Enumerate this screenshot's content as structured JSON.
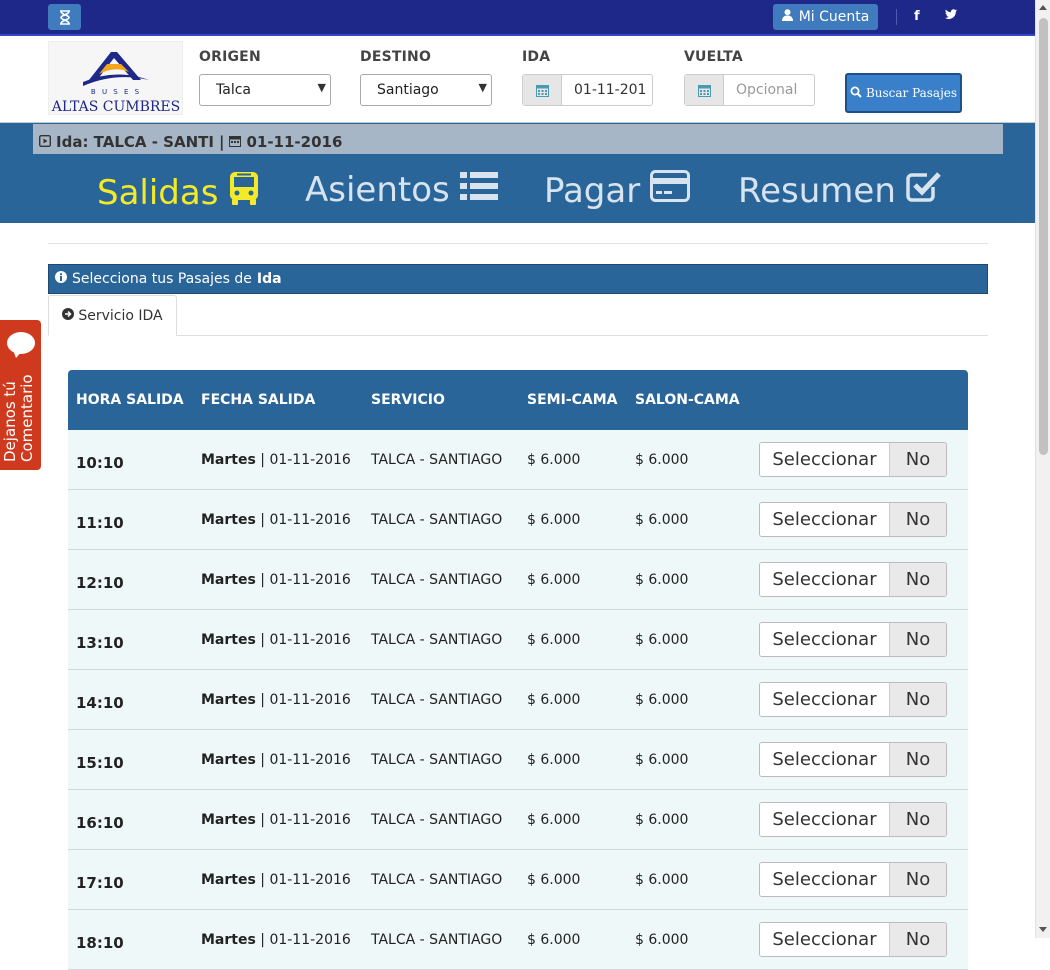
{
  "topbar": {
    "account_label": "Mi Cuenta",
    "facebook_label": "f",
    "twitter_label": "t"
  },
  "logo": {
    "top_text": "B U S E S",
    "brand": "ALTAS CUMBRES"
  },
  "search": {
    "origin_label": "ORIGEN",
    "origin_value": "Talca",
    "destination_label": "DESTINO",
    "destination_value": "Santiago",
    "ida_label": "IDA",
    "ida_value": "01-11-201",
    "vuelta_label": "VUELTA",
    "vuelta_placeholder": "Opcional",
    "button_label": "Buscar Pasajes"
  },
  "trip_summary": {
    "route": "Ida: TALCA - SANTI",
    "separator": "|",
    "date": "01-11-2016"
  },
  "steps": [
    {
      "label": "Salidas",
      "icon": "bus-icon",
      "active": true
    },
    {
      "label": "Asientos",
      "icon": "list-icon",
      "active": false
    },
    {
      "label": "Pagar",
      "icon": "credit-card-icon",
      "active": false
    },
    {
      "label": "Resumen",
      "icon": "check-square-icon",
      "active": false
    }
  ],
  "info": {
    "prefix": "Selecciona tus Pasajes de",
    "bold": "Ida"
  },
  "tab": {
    "label": "Servicio IDA"
  },
  "table": {
    "headers": {
      "hora": "HORA SALIDA",
      "fecha": "FECHA SALIDA",
      "servicio": "SERVICIO",
      "semi": "SEMI-CAMA",
      "salon": "SALON-CAMA"
    },
    "select_label": "Seleccionar",
    "toggle_label": "No",
    "rows": [
      {
        "hora": "10:10",
        "dia": "Martes",
        "fecha": "01-11-2016",
        "servicio": "TALCA - SANTIAGO",
        "semi": "$ 6.000",
        "salon": "$ 6.000"
      },
      {
        "hora": "11:10",
        "dia": "Martes",
        "fecha": "01-11-2016",
        "servicio": "TALCA - SANTIAGO",
        "semi": "$ 6.000",
        "salon": "$ 6.000"
      },
      {
        "hora": "12:10",
        "dia": "Martes",
        "fecha": "01-11-2016",
        "servicio": "TALCA - SANTIAGO",
        "semi": "$ 6.000",
        "salon": "$ 6.000"
      },
      {
        "hora": "13:10",
        "dia": "Martes",
        "fecha": "01-11-2016",
        "servicio": "TALCA - SANTIAGO",
        "semi": "$ 6.000",
        "salon": "$ 6.000"
      },
      {
        "hora": "14:10",
        "dia": "Martes",
        "fecha": "01-11-2016",
        "servicio": "TALCA - SANTIAGO",
        "semi": "$ 6.000",
        "salon": "$ 6.000"
      },
      {
        "hora": "15:10",
        "dia": "Martes",
        "fecha": "01-11-2016",
        "servicio": "TALCA - SANTIAGO",
        "semi": "$ 6.000",
        "salon": "$ 6.000"
      },
      {
        "hora": "16:10",
        "dia": "Martes",
        "fecha": "01-11-2016",
        "servicio": "TALCA - SANTIAGO",
        "semi": "$ 6.000",
        "salon": "$ 6.000"
      },
      {
        "hora": "17:10",
        "dia": "Martes",
        "fecha": "01-11-2016",
        "servicio": "TALCA - SANTIAGO",
        "semi": "$ 6.000",
        "salon": "$ 6.000"
      },
      {
        "hora": "18:10",
        "dia": "Martes",
        "fecha": "01-11-2016",
        "servicio": "TALCA - SANTIAGO",
        "semi": "$ 6.000",
        "salon": "$ 6.000"
      }
    ]
  },
  "feedback": {
    "label": "Dejanos tú Comentario"
  },
  "colors": {
    "topbar": "#1d2888",
    "band": "#2a6599",
    "active_step": "#f5ea27",
    "feedback": "#cf3a1f"
  }
}
